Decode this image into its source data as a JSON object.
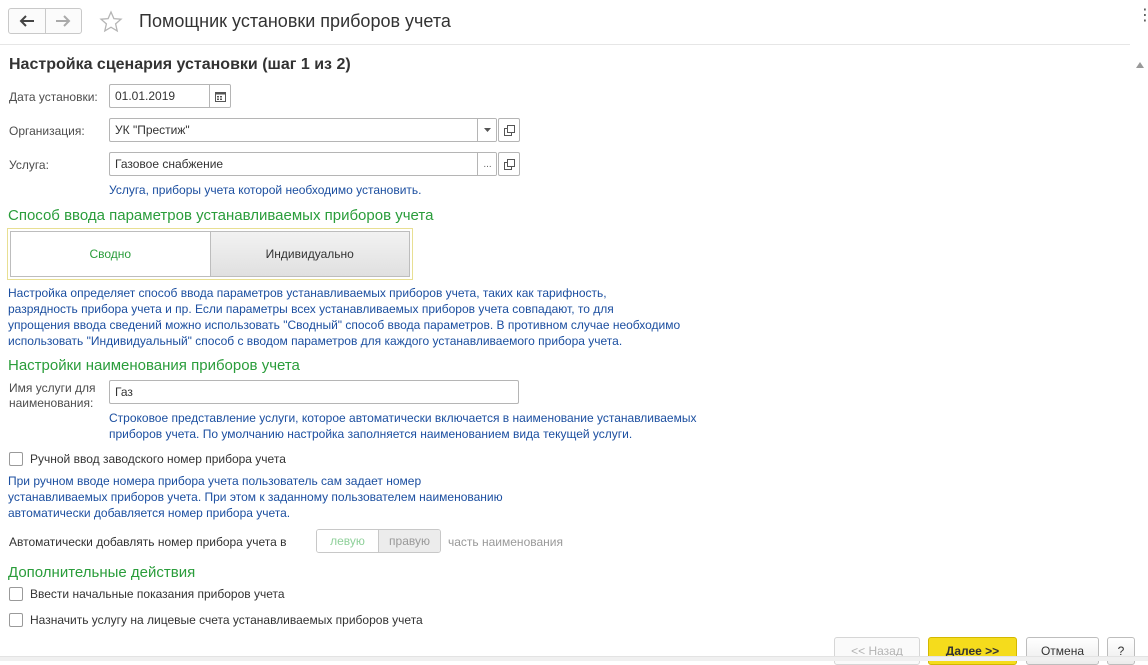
{
  "window": {
    "title": "Помощник установки приборов учета",
    "more_glyph": "⋮"
  },
  "nav": {
    "back_icon": "arrow-left-icon",
    "forward_icon": "arrow-right-icon",
    "favorite_icon": "star-icon"
  },
  "heading": "Настройка сценария установки (шаг 1 из 2)",
  "install_date": {
    "label": "Дата установки:",
    "value": "01.01.2019",
    "icon": "calendar-icon"
  },
  "organization": {
    "label": "Организация:",
    "value": "УК \"Престиж\"",
    "dropdown_icon": "triangle-down-icon",
    "open_icon": "open-form-icon"
  },
  "service": {
    "label": "Услуга:",
    "value": "Газовое снабжение",
    "select_glyph": "...",
    "open_icon": "open-form-icon",
    "hint": "Услуга, приборы учета которой необходимо установить."
  },
  "input_method": {
    "heading": "Способ ввода параметров устанавливаемых приборов учета",
    "options": [
      "Сводно",
      "Индивидуально"
    ],
    "selected": "Индивидуально",
    "hint_lines": [
      "Настройка определяет способ ввода параметров устанавливаемых приборов учета, таких как тарифность,",
      "разрядность прибора учета и пр. Если параметры всех устанавливаемых приборов учета совпадают, то для",
      "упрощения ввода сведений можно использовать \"Сводный\" способ ввода параметров. В противном случае необходимо",
      "использовать \"Индивидуальный\" способ с вводом параметров для каждого устанавливаемого прибора учета."
    ]
  },
  "naming": {
    "heading": "Настройки наименования приборов учета",
    "label_line1": "Имя услуги для",
    "label_line2": "наименования:",
    "value": "Газ",
    "hint_lines": [
      "Строковое представление услуги, которое автоматически включается в наименование устанавливаемых",
      "приборов учета. По умолчанию настройка заполняется наименованием вида текущей услуги."
    ],
    "manual_serial_label": "Ручной ввод заводского номер прибора учета",
    "manual_serial_checked": false,
    "manual_hint_lines": [
      "При ручном вводе номера прибора учета пользователь сам задает номер",
      "устанавливаемых приборов учета. При этом к заданному пользователем наименованию",
      "автоматически добавляется номер прибора учета."
    ],
    "auto_add_label": "Автоматически добавлять номер прибора учета в",
    "auto_add_options": [
      "левую",
      "правую"
    ],
    "auto_add_selected": "правую",
    "auto_add_suffix": "часть наименования"
  },
  "extra": {
    "heading": "Дополнительные действия",
    "enter_readings_label": "Ввести начальные показания приборов учета",
    "enter_readings_checked": false,
    "assign_service_label": "Назначить услугу на лицевые счета устанавливаемых приборов учета",
    "assign_service_checked": false
  },
  "footer": {
    "back_label": "<< Назад",
    "next_label": "Далее >>",
    "cancel_label": "Отмена",
    "help_label": "?"
  },
  "colors": {
    "accent_yellow": "#f5dc1c",
    "section_green": "#2a9d3b",
    "hint_blue": "#1c4fa0"
  }
}
